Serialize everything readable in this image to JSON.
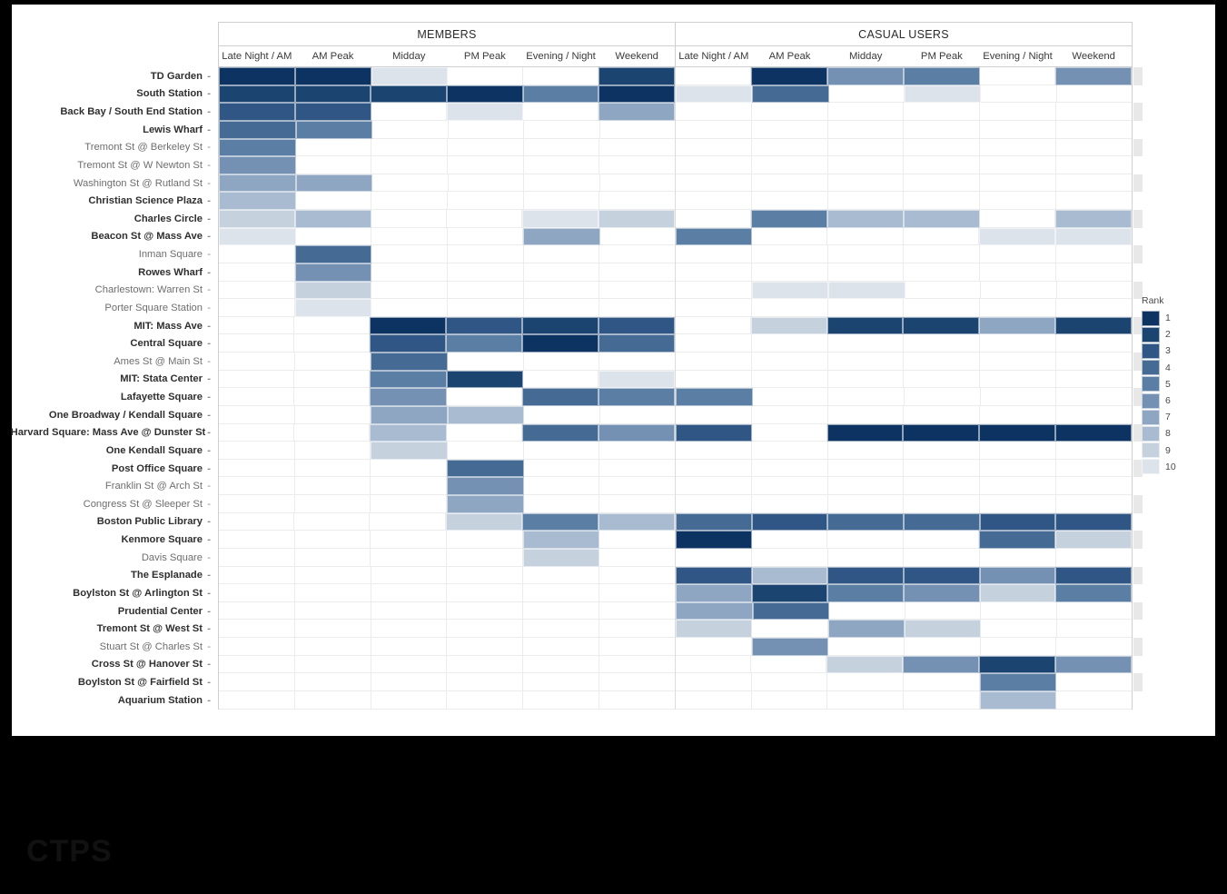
{
  "watermark": "CTPS",
  "legend": {
    "title": "Rank",
    "labels": [
      "1",
      "2",
      "3",
      "4",
      "5",
      "6",
      "7",
      "8",
      "9",
      "10"
    ],
    "colors": [
      "#0d3362",
      "#1b4471",
      "#2f5684",
      "#456a94",
      "#5b7ea5",
      "#7491b4",
      "#8fa6c3",
      "#a8bbd0",
      "#c5d2de",
      "#dde3ea"
    ]
  },
  "chart_data": {
    "type": "heatmap",
    "title": "",
    "xlabel": "",
    "ylabel": "",
    "legend_title": "Rank",
    "value_range": [
      1,
      10
    ],
    "grid": true,
    "legend_position": "right",
    "groups": [
      "MEMBERS",
      "CASUAL USERS"
    ],
    "columns": [
      "Late Night / AM",
      "AM Peak",
      "Midday",
      "PM Peak",
      "Evening / Night",
      "Weekend"
    ],
    "rows": [
      {
        "label": "TD Garden",
        "bold": true,
        "members": [
          1,
          1,
          10,
          null,
          null,
          2
        ],
        "casual": [
          null,
          1,
          6,
          5,
          null,
          6
        ]
      },
      {
        "label": "South Station",
        "bold": true,
        "members": [
          2,
          2,
          2,
          1,
          5,
          1
        ],
        "casual": [
          10,
          4,
          null,
          10,
          null,
          null
        ]
      },
      {
        "label": "Back Bay / South End Station",
        "bold": true,
        "members": [
          3,
          3,
          null,
          10,
          null,
          7
        ],
        "casual": [
          null,
          null,
          null,
          null,
          null,
          null
        ]
      },
      {
        "label": "Lewis Wharf",
        "bold": true,
        "members": [
          4,
          5,
          null,
          null,
          null,
          null
        ],
        "casual": [
          null,
          null,
          null,
          null,
          null,
          null
        ]
      },
      {
        "label": "Tremont St @ Berkeley St",
        "bold": false,
        "members": [
          5,
          null,
          null,
          null,
          null,
          null
        ],
        "casual": [
          null,
          null,
          null,
          null,
          null,
          null
        ]
      },
      {
        "label": "Tremont St @ W Newton St",
        "bold": false,
        "members": [
          6,
          null,
          null,
          null,
          null,
          null
        ],
        "casual": [
          null,
          null,
          null,
          null,
          null,
          null
        ]
      },
      {
        "label": "Washington St @ Rutland St",
        "bold": false,
        "members": [
          7,
          7,
          null,
          null,
          null,
          null
        ],
        "casual": [
          null,
          null,
          null,
          null,
          null,
          null
        ]
      },
      {
        "label": "Christian Science Plaza",
        "bold": true,
        "members": [
          8,
          null,
          null,
          null,
          null,
          null
        ],
        "casual": [
          null,
          null,
          null,
          null,
          null,
          null
        ]
      },
      {
        "label": "Charles Circle",
        "bold": true,
        "members": [
          9,
          8,
          null,
          null,
          10,
          9
        ],
        "casual": [
          null,
          5,
          8,
          8,
          null,
          8
        ]
      },
      {
        "label": "Beacon St @ Mass Ave",
        "bold": true,
        "members": [
          10,
          null,
          null,
          null,
          7,
          null
        ],
        "casual": [
          5,
          null,
          null,
          null,
          10,
          10
        ]
      },
      {
        "label": "Inman Square",
        "bold": false,
        "members": [
          null,
          4,
          null,
          null,
          null,
          null
        ],
        "casual": [
          null,
          null,
          null,
          null,
          null,
          null
        ]
      },
      {
        "label": "Rowes Wharf",
        "bold": true,
        "members": [
          null,
          6,
          null,
          null,
          null,
          null
        ],
        "casual": [
          null,
          null,
          null,
          null,
          null,
          null
        ]
      },
      {
        "label": "Charlestown: Warren St",
        "bold": false,
        "members": [
          null,
          9,
          null,
          null,
          null,
          null
        ],
        "casual": [
          null,
          10,
          10,
          null,
          null,
          null
        ]
      },
      {
        "label": "Porter Square Station",
        "bold": false,
        "members": [
          null,
          10,
          null,
          null,
          null,
          null
        ],
        "casual": [
          null,
          null,
          null,
          null,
          null,
          null
        ]
      },
      {
        "label": "MIT: Mass Ave",
        "bold": true,
        "members": [
          null,
          null,
          1,
          3,
          2,
          3
        ],
        "casual": [
          null,
          9,
          2,
          2,
          7,
          2
        ]
      },
      {
        "label": "Central Square",
        "bold": true,
        "members": [
          null,
          null,
          3,
          5,
          1,
          4
        ],
        "casual": [
          null,
          null,
          null,
          null,
          null,
          null
        ]
      },
      {
        "label": "Ames St @ Main St",
        "bold": false,
        "members": [
          null,
          null,
          4,
          null,
          null,
          null
        ],
        "casual": [
          null,
          null,
          null,
          null,
          null,
          null
        ]
      },
      {
        "label": "MIT: Stata Center",
        "bold": true,
        "members": [
          null,
          null,
          5,
          2,
          null,
          10
        ],
        "casual": [
          null,
          null,
          null,
          null,
          null,
          null
        ]
      },
      {
        "label": "Lafayette Square",
        "bold": true,
        "members": [
          null,
          null,
          6,
          null,
          4,
          5
        ],
        "casual": [
          5,
          null,
          null,
          null,
          null,
          null
        ]
      },
      {
        "label": "One Broadway / Kendall Square",
        "bold": true,
        "members": [
          null,
          null,
          7,
          8,
          null,
          null
        ],
        "casual": [
          null,
          null,
          null,
          null,
          null,
          null
        ]
      },
      {
        "label": "Harvard Square: Mass Ave @ Dunster St",
        "bold": true,
        "members": [
          null,
          null,
          8,
          null,
          4,
          6
        ],
        "casual": [
          3,
          null,
          1,
          1,
          1,
          1
        ]
      },
      {
        "label": "One Kendall Square",
        "bold": true,
        "members": [
          null,
          null,
          9,
          null,
          null,
          null
        ],
        "casual": [
          null,
          null,
          null,
          null,
          null,
          null
        ]
      },
      {
        "label": "Post Office Square",
        "bold": true,
        "members": [
          null,
          null,
          null,
          4,
          null,
          null
        ],
        "casual": [
          null,
          null,
          null,
          null,
          null,
          null
        ]
      },
      {
        "label": "Franklin St @ Arch St",
        "bold": false,
        "members": [
          null,
          null,
          null,
          6,
          null,
          null
        ],
        "casual": [
          null,
          null,
          null,
          null,
          null,
          null
        ]
      },
      {
        "label": "Congress St @ Sleeper St",
        "bold": false,
        "members": [
          null,
          null,
          null,
          7,
          null,
          null
        ],
        "casual": [
          null,
          null,
          null,
          null,
          null,
          null
        ]
      },
      {
        "label": "Boston Public Library",
        "bold": true,
        "members": [
          null,
          null,
          null,
          9,
          5,
          8
        ],
        "casual": [
          4,
          3,
          4,
          4,
          3,
          3
        ]
      },
      {
        "label": "Kenmore Square",
        "bold": true,
        "members": [
          null,
          null,
          null,
          null,
          8,
          null
        ],
        "casual": [
          1,
          null,
          null,
          null,
          4,
          9
        ]
      },
      {
        "label": "Davis Square",
        "bold": false,
        "members": [
          null,
          null,
          null,
          null,
          9,
          null
        ],
        "casual": [
          null,
          null,
          null,
          null,
          null,
          null
        ]
      },
      {
        "label": "The Esplanade",
        "bold": true,
        "members": [
          null,
          null,
          null,
          null,
          null,
          null
        ],
        "casual": [
          3,
          8,
          3,
          3,
          6,
          3
        ]
      },
      {
        "label": "Boylston St @ Arlington St",
        "bold": true,
        "members": [
          null,
          null,
          null,
          null,
          null,
          null
        ],
        "casual": [
          7,
          2,
          5,
          6,
          9,
          5
        ]
      },
      {
        "label": "Prudential Center",
        "bold": true,
        "members": [
          null,
          null,
          null,
          null,
          null,
          null
        ],
        "casual": [
          7,
          4,
          null,
          null,
          null,
          null
        ]
      },
      {
        "label": "Tremont St @ West St",
        "bold": true,
        "members": [
          null,
          null,
          null,
          null,
          null,
          null
        ],
        "casual": [
          9,
          null,
          7,
          9,
          null,
          null
        ]
      },
      {
        "label": "Stuart St @ Charles St",
        "bold": false,
        "members": [
          null,
          null,
          null,
          null,
          null,
          null
        ],
        "casual": [
          null,
          6,
          null,
          null,
          null,
          null
        ]
      },
      {
        "label": "Cross St @ Hanover St",
        "bold": true,
        "members": [
          null,
          null,
          null,
          null,
          null,
          null
        ],
        "casual": [
          null,
          null,
          9,
          6,
          2,
          6
        ]
      },
      {
        "label": "Boylston St @ Fairfield St",
        "bold": true,
        "members": [
          null,
          null,
          null,
          null,
          null,
          null
        ],
        "casual": [
          null,
          null,
          null,
          null,
          5,
          null
        ]
      },
      {
        "label": "Aquarium Station",
        "bold": true,
        "members": [
          null,
          null,
          null,
          null,
          null,
          null
        ],
        "casual": [
          null,
          null,
          null,
          null,
          8,
          null
        ]
      }
    ]
  }
}
